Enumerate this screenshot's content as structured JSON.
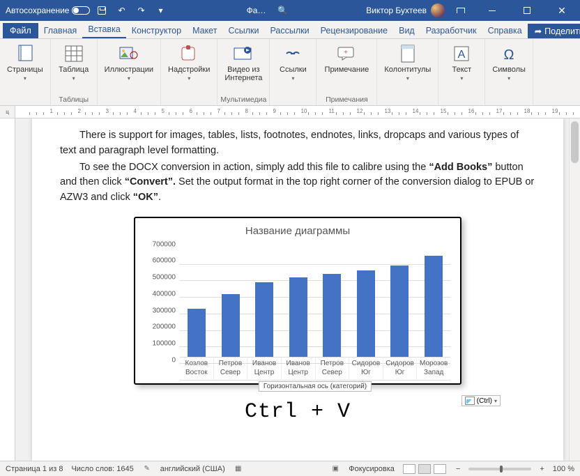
{
  "title_bar": {
    "autosave_label": "Автосохранение",
    "doc_abbrev": "Фа…",
    "search_glyph": "🔍",
    "user_name": "Виктор Бухтеев"
  },
  "tabs": {
    "file": "Файл",
    "items": [
      "Главная",
      "Вставка",
      "Конструктор",
      "Макет",
      "Ссылки",
      "Рассылки",
      "Рецензирование",
      "Вид",
      "Разработчик",
      "Справка"
    ],
    "active_index": 1,
    "share": "Поделиться"
  },
  "ribbon": {
    "pages": "Страницы",
    "table": "Таблица",
    "tables_group": "Таблицы",
    "illustrations": "Иллюстрации",
    "addins": "Надстройки",
    "online_video_l1": "Видео из",
    "online_video_l2": "Интернета",
    "media_group": "Мультимедиа",
    "links": "Ссылки",
    "comment": "Примечание",
    "comments_group": "Примечания",
    "headerfooter": "Колонтитулы",
    "text": "Текст",
    "symbols": "Символы"
  },
  "ruler_corner": "ц",
  "body": {
    "p1": "There is support for images, tables, lists, footnotes, endnotes, links, dropcaps and various types of text and paragraph level formatting.",
    "p2_a": "To see the DOCX conversion in action, simply add this file to calibre using the ",
    "p2_b": "“Add Books”",
    "p2_c": " button and then click ",
    "p2_d": "“Convert”.",
    "p2_e": "  Set the output format in the top right corner of the conversion dialog to EPUB or AZW3 and click ",
    "p2_f": "“OK”",
    "p2_g": "."
  },
  "chart_data": {
    "type": "bar",
    "title": "Название диаграммы",
    "categories_top": [
      "Козлов",
      "Петров",
      "Иванов",
      "Иванов",
      "Петров",
      "Сидоров",
      "Сидоров",
      "Морозов"
    ],
    "categories_bottom": [
      "Восток",
      "Север",
      "Центр",
      "Центр",
      "Север",
      "Юг",
      "Юг",
      "Запад"
    ],
    "values": [
      290000,
      380000,
      450000,
      480000,
      500000,
      520000,
      550000,
      610000
    ],
    "ylim": [
      0,
      700000
    ],
    "yticks": [
      0,
      100000,
      200000,
      300000,
      400000,
      500000,
      600000,
      700000
    ],
    "axis_tooltip": "Горизонтальная ось (категорий)"
  },
  "paste_hint": {
    "ctrl": "(Ctrl)",
    "big_text": "Ctrl + V"
  },
  "status": {
    "page": "Страница 1 из 8",
    "words": "Число слов: 1645",
    "lang": "английский (США)",
    "focus": "Фокусировка",
    "zoom": "100 %"
  }
}
